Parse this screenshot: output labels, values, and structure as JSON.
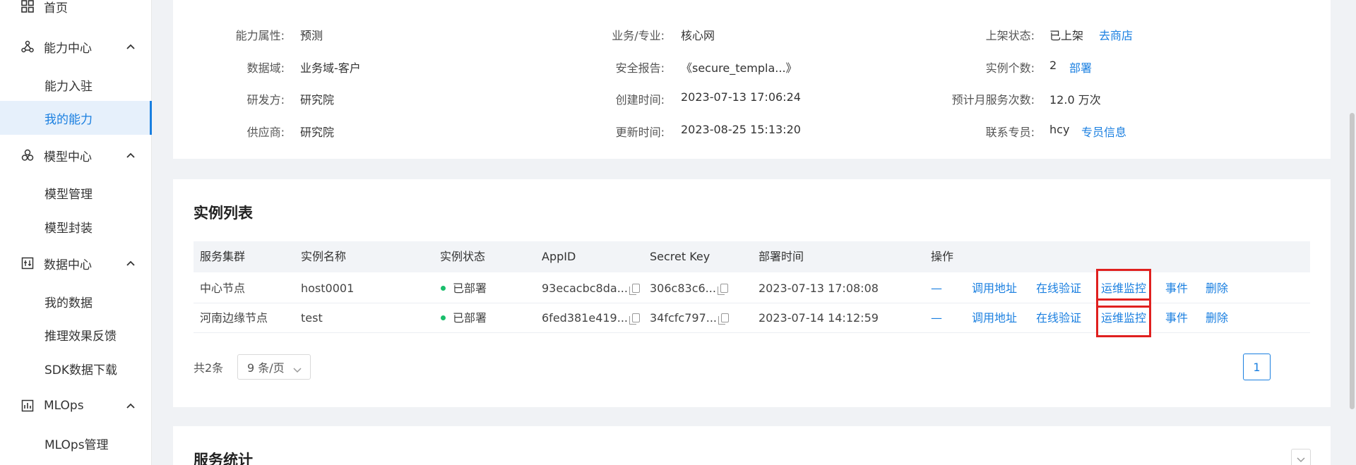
{
  "sidebar": {
    "items": [
      {
        "label": "首页",
        "icon": "home-grid-icon"
      },
      {
        "label": "能力中心",
        "icon": "cluster-icon"
      },
      {
        "label": "能力入驻"
      },
      {
        "label": "我的能力"
      },
      {
        "label": "模型中心",
        "icon": "model-icon"
      },
      {
        "label": "模型管理"
      },
      {
        "label": "模型封装"
      },
      {
        "label": "数据中心",
        "icon": "data-icon"
      },
      {
        "label": "我的数据"
      },
      {
        "label": "推理效果反馈"
      },
      {
        "label": "SDK数据下载"
      },
      {
        "label": "MLOps",
        "icon": "mlops-icon"
      },
      {
        "label": "MLOps管理"
      }
    ]
  },
  "info": {
    "col1": [
      {
        "label": "能力属性:",
        "value": "预测"
      },
      {
        "label": "数据域:",
        "value": "业务域-客户"
      },
      {
        "label": "研发方:",
        "value": "研究院"
      },
      {
        "label": "供应商:",
        "value": "研究院"
      }
    ],
    "col2": [
      {
        "label": "业务/专业:",
        "value": "核心网"
      },
      {
        "label": "安全报告:",
        "value": "《secure_templa...》"
      },
      {
        "label": "创建时间:",
        "value": "2023-07-13 17:06:24"
      },
      {
        "label": "更新时间:",
        "value": "2023-08-25 15:13:20"
      }
    ],
    "col3": [
      {
        "label": "上架状态:",
        "value": "已上架",
        "link": "去商店"
      },
      {
        "label": "实例个数:",
        "value": "2",
        "link": "部署"
      },
      {
        "label": "预计月服务次数:",
        "value": "12.0 万次"
      },
      {
        "label": "联系专员:",
        "value": "hcy",
        "link": "专员信息"
      }
    ]
  },
  "instances": {
    "title": "实例列表",
    "columns": [
      "服务集群",
      "实例名称",
      "实例状态",
      "AppID",
      "Secret Key",
      "部署时间",
      "操作"
    ],
    "rows": [
      {
        "cluster": "中心节点",
        "name": "host0001",
        "status": "已部署",
        "appid": "93ecacbc8da...",
        "secret": "306c83c6...",
        "time": "2023-07-13 17:08:08"
      },
      {
        "cluster": "河南边缘节点",
        "name": "test",
        "status": "已部署",
        "appid": "6fed381e419...",
        "secret": "34fcfc797...",
        "time": "2023-07-14 14:12:59"
      }
    ],
    "actions": [
      "—",
      "调用地址",
      "在线验证",
      "运维监控",
      "事件",
      "删除"
    ],
    "total": "共2条",
    "page_size": "9 条/页",
    "page": "1"
  },
  "stats": {
    "title": "服务统计"
  },
  "colors": {
    "accent": "#1a7fe0",
    "status_ok": "#19be6b",
    "highlight": "#e0201f"
  }
}
